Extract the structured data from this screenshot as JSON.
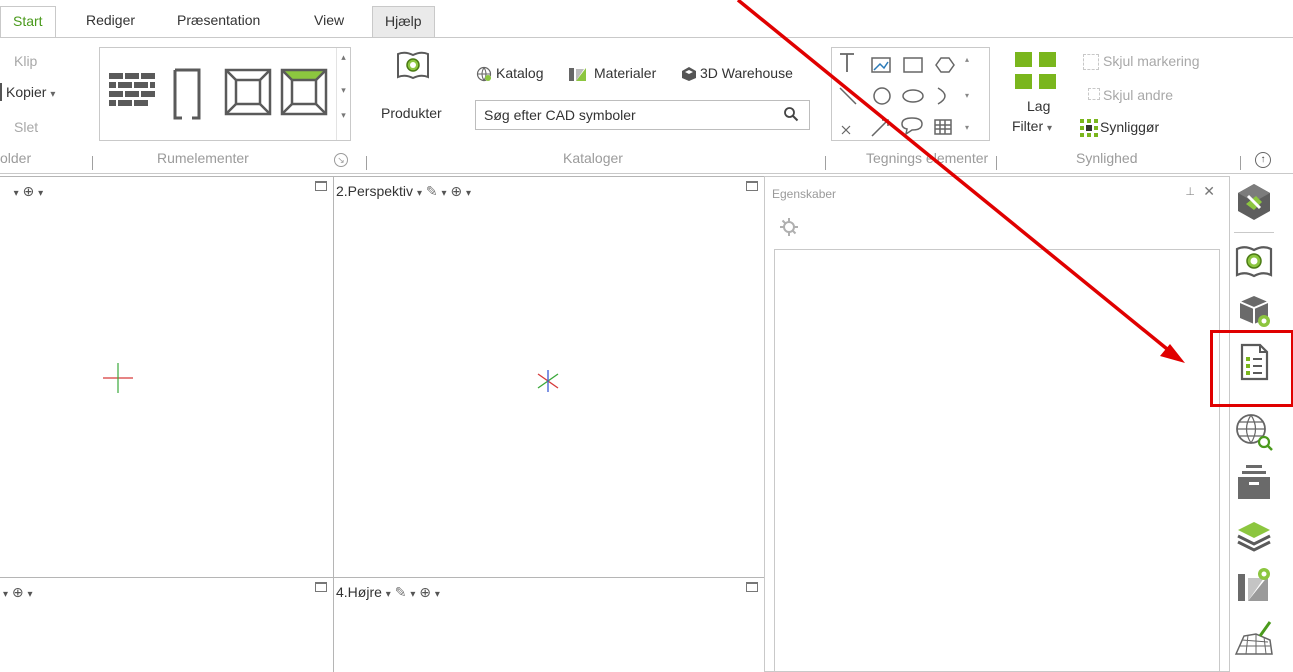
{
  "tabs": [
    "Start",
    "Rediger",
    "Præsentation",
    "View",
    "Hjælp"
  ],
  "clipboard": {
    "cut": "Klip",
    "copy": "Kopier",
    "delete": "Slet",
    "group_label": "older"
  },
  "room_elements": {
    "group_label": "Rumelementer"
  },
  "catalogs": {
    "products_label": "Produkter",
    "catalog_label": "Katalog",
    "materials_label": "Materialer",
    "warehouse_label": "3D Warehouse",
    "search_placeholder": "Søg efter CAD symboler",
    "group_label": "Kataloger"
  },
  "drawing_elements": {
    "group_label": "Tegnings elementer"
  },
  "visibility": {
    "layer_label": "Lag",
    "filter_label": "Filter",
    "hide_selection": "Skjul markering",
    "hide_others": "Skjul andre",
    "make_visible": "Synliggør",
    "group_label": "Synlighed"
  },
  "viewports": {
    "v1_title": "   ",
    "v2_title": "2.Perspektiv",
    "v3_title": "",
    "v4_title": "4.Højre"
  },
  "properties": {
    "title": "Egenskaber"
  },
  "colors": {
    "accent_green": "#7ab61d",
    "highlight_red": "#e00000",
    "active_tab": "#4a9a1c"
  },
  "sidebar_icons": [
    "tools-icon",
    "product-catalog-icon",
    "package-settings-icon",
    "properties-list-icon",
    "web-search-icon",
    "archive-icon",
    "layers-icon",
    "material-settings-icon",
    "terrain-edit-icon"
  ]
}
